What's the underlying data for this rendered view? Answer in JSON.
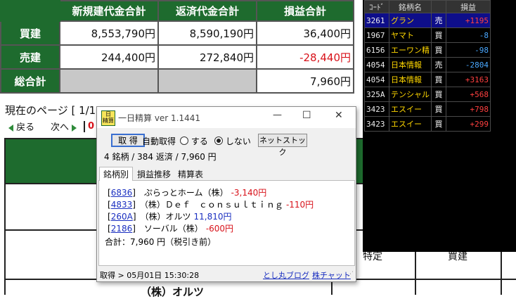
{
  "summary": {
    "headers": [
      "新規建代金合計",
      "返済代金合計",
      "損益合計"
    ],
    "rows": [
      {
        "label": "買建",
        "new": "8,553,790円",
        "repay": "8,590,190円",
        "pl": "36,400円",
        "pl_negative": false
      },
      {
        "label": "売建",
        "new": "244,400円",
        "repay": "272,840円",
        "pl": "-28,440円",
        "pl_negative": true
      },
      {
        "label": "総合計",
        "new": "",
        "repay": "",
        "pl": "7,960円",
        "pl_negative": false
      }
    ]
  },
  "pager": {
    "page_label": "現在のページ [ 1/1",
    "back": "戻る",
    "next": "次へ",
    "partial": "0"
  },
  "background_table": {
    "col_tokutei": "特定",
    "col_kaidate": "買建",
    "bottom_text": "（株）オルツ"
  },
  "right_panel": {
    "headers": [
      "ｺｰﾄﾞ",
      "銘柄名",
      "",
      "損益"
    ],
    "rows": [
      {
        "code": "3261",
        "name": "グラン",
        "side": "売",
        "pl": "+1195",
        "color": "#ff4040",
        "selected": true
      },
      {
        "code": "1967",
        "name": "ヤマト",
        "side": "買",
        "pl": "-8",
        "color": "#4aa8ff",
        "selected": false
      },
      {
        "code": "6156",
        "name": "エーワン精",
        "side": "買",
        "pl": "-98",
        "color": "#4aa8ff",
        "selected": false
      },
      {
        "code": "4054",
        "name": "日本情報",
        "side": "売",
        "pl": "-2804",
        "color": "#4aa8ff",
        "selected": false
      },
      {
        "code": "4054",
        "name": "日本情報",
        "side": "買",
        "pl": "+3163",
        "color": "#ff4040",
        "selected": false
      },
      {
        "code": "325A",
        "name": "テンシャル",
        "side": "買",
        "pl": "+568",
        "color": "#ff4040",
        "selected": false
      },
      {
        "code": "3423",
        "name": "エスイー",
        "side": "買",
        "pl": "+798",
        "color": "#ff4040",
        "selected": false
      },
      {
        "code": "3423",
        "name": "エスイー",
        "side": "買",
        "pl": "+299",
        "color": "#ff4040",
        "selected": false
      }
    ]
  },
  "window": {
    "app_icon_text": "日\n精算",
    "title": "一日精算 ver 1.1441",
    "controls": {
      "minimize": "—",
      "maximize": "☐",
      "close": "✕"
    },
    "fetch_button": "取 得",
    "auto_fetch_label": "自動取得",
    "radio_on_label": "する",
    "radio_off_label": "しない",
    "auto_fetch_selected": "しない",
    "netstock_button": "ネットストック",
    "summary_line": "4 銘柄 / 384 返済 / 7,960 円",
    "tabs": [
      "銘柄別",
      "損益推移",
      "精算表"
    ],
    "active_tab": "銘柄別",
    "entries": [
      {
        "code": "6836",
        "name": "ぷらっとホーム（株）",
        "value": "-3,140円",
        "positive": false
      },
      {
        "code": "4833",
        "name": "（株）Ｄｅｆ　ｃｏｎｓｕｌｔｉｎｇ",
        "value": "-110円",
        "positive": false
      },
      {
        "code": "260A",
        "name": "（株）オルツ",
        "value": "11,810円",
        "positive": true
      },
      {
        "code": "2186",
        "name": "ソーバル（株）",
        "value": "-600円",
        "positive": false
      }
    ],
    "total_line": "合計：7,960 円（税引き前）",
    "status": "取得 > 05月01日 15:30:28",
    "link_blog": "とし丸ブログ",
    "link_chat": "株チャット"
  }
}
